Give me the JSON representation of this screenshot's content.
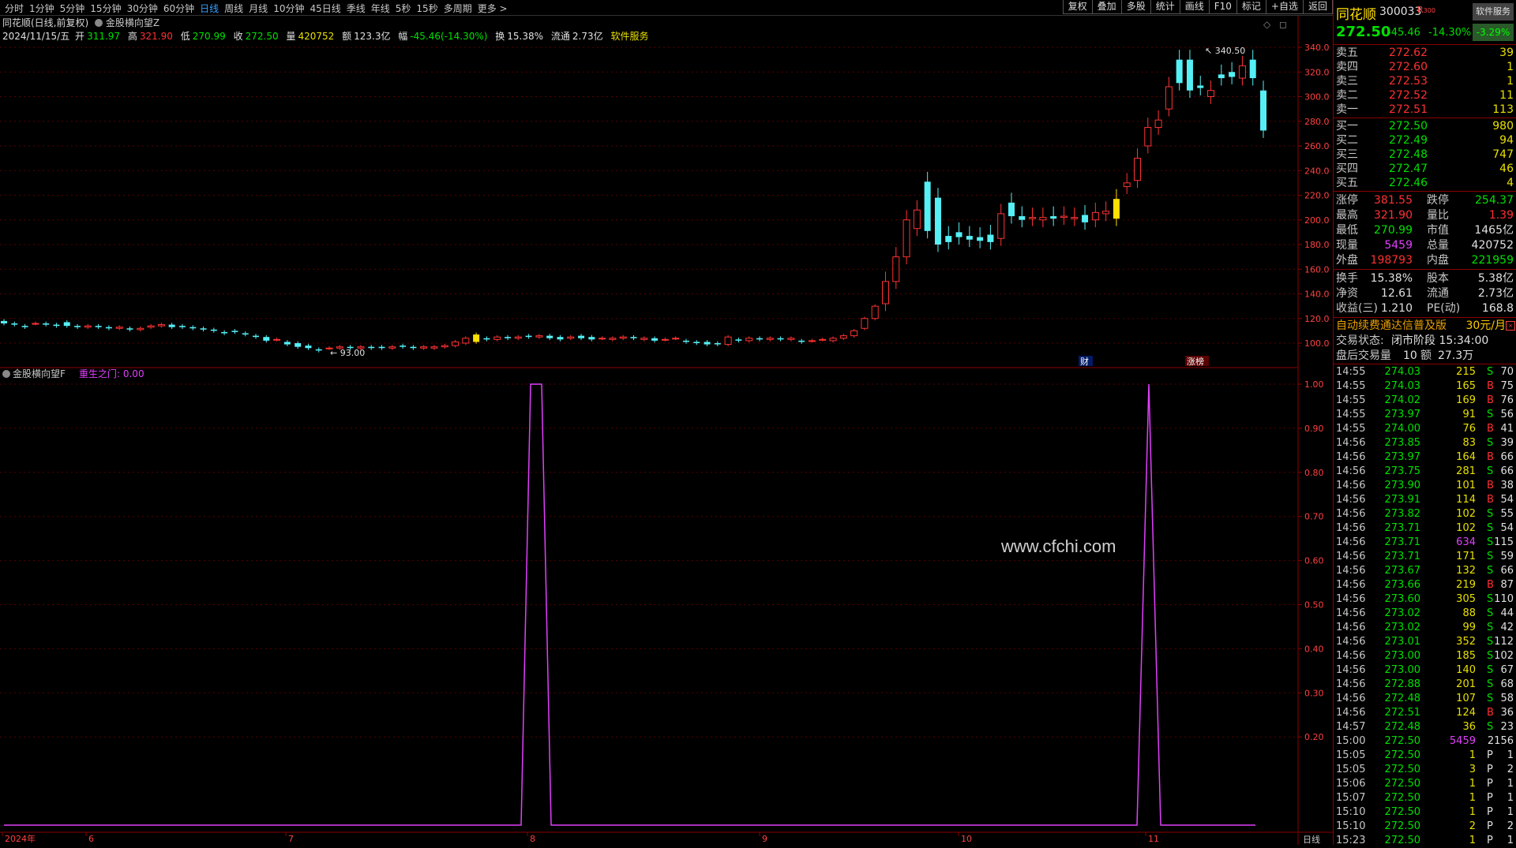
{
  "toolbar": {
    "periods": [
      "分时",
      "1分钟",
      "5分钟",
      "15分钟",
      "30分钟",
      "60分钟",
      "日线",
      "周线",
      "月线",
      "10分钟",
      "45日线",
      "季线",
      "年线",
      "5秒",
      "15秒",
      "多周期",
      "更多 >"
    ],
    "active": "日线",
    "right": [
      "复权",
      "叠加",
      "多股",
      "统计",
      "画线",
      "F10",
      "标记",
      "+自选",
      "返回"
    ]
  },
  "chart_title": "同花顺(日线,前复权)",
  "indicator_main": "金股横向望Z",
  "info": {
    "date": "2024/11/15/五",
    "open_label": "开",
    "open": "311.97",
    "high_label": "高",
    "high": "321.90",
    "low_label": "低",
    "low": "270.99",
    "close_label": "收",
    "close": "272.50",
    "vol_label": "量",
    "vol": "420752",
    "amt_label": "额",
    "amt": "123.3亿",
    "chg_label": "幅",
    "chg": "-45.46(-14.30%)",
    "turn_label": "换",
    "turn": "15.38%",
    "float_label": "流通",
    "float": "2.73亿",
    "service": "软件服务"
  },
  "price_axis": [
    "340.0",
    "320.0",
    "300.0",
    "280.0",
    "260.0",
    "240.0",
    "220.0",
    "200.0",
    "180.0",
    "160.0",
    "140.0",
    "120.0",
    "100.0"
  ],
  "price_high_label": "340.50",
  "price_low_label": "93.00",
  "tags": {
    "cai": "财",
    "zhangbang": "涨榜"
  },
  "indicator_sub": {
    "name": "金股横向望F",
    "param_label": "重生之门:",
    "param_value": "0.00"
  },
  "sub_axis": [
    "1.00",
    "0.90",
    "0.80",
    "0.70",
    "0.60",
    "0.50",
    "0.40",
    "0.30",
    "0.20"
  ],
  "x_axis": [
    "2024年",
    "6",
    "7",
    "8",
    "9",
    "10",
    "11"
  ],
  "period_label": "日线",
  "watermark": "www.cfchi.com",
  "chart_data": {
    "type": "line",
    "title": "",
    "series": [
      {
        "name": "重生之门",
        "x": [
          "2024-05-06",
          "2024-07-31",
          "2024-08-01",
          "2024-08-02",
          "2024-08-05",
          "2024-10-31",
          "2024-11-01",
          "2024-11-04",
          "2024-11-15"
        ],
        "values": [
          0,
          0,
          1,
          1,
          0,
          0,
          1,
          0,
          0
        ]
      }
    ],
    "ylim": [
      0,
      1
    ],
    "price_range": [
      93.0,
      340.5
    ]
  },
  "side": {
    "name": "同花顺",
    "code": "300033",
    "r_label": "R",
    "r_num": "300",
    "soft_btn": "软件服务",
    "price": "272.50",
    "change": "-45.46",
    "pct": "-14.30%",
    "sector_pct": "-3.29%",
    "asks": [
      {
        "l": "卖五",
        "p": "272.62",
        "v": "39"
      },
      {
        "l": "卖四",
        "p": "272.60",
        "v": "1"
      },
      {
        "l": "卖三",
        "p": "272.53",
        "v": "1"
      },
      {
        "l": "卖二",
        "p": "272.52",
        "v": "11"
      },
      {
        "l": "卖一",
        "p": "272.51",
        "v": "113"
      }
    ],
    "bids": [
      {
        "l": "买一",
        "p": "272.50",
        "v": "980"
      },
      {
        "l": "买二",
        "p": "272.49",
        "v": "94"
      },
      {
        "l": "买三",
        "p": "272.48",
        "v": "747"
      },
      {
        "l": "买四",
        "p": "272.47",
        "v": "46"
      },
      {
        "l": "买五",
        "p": "272.46",
        "v": "4"
      }
    ],
    "stats": [
      {
        "l": "涨停",
        "v": "381.55",
        "l2": "跌停",
        "v2": "254.37",
        "c1": "rd",
        "c2": "g"
      },
      {
        "l": "最高",
        "v": "321.90",
        "l2": "量比",
        "v2": "1.39",
        "c1": "rd",
        "c2": "rd"
      },
      {
        "l": "最低",
        "v": "270.99",
        "l2": "市值",
        "v2": "1465亿",
        "c1": "g",
        "c2": "w"
      },
      {
        "l": "现量",
        "v": "5459",
        "l2": "总量",
        "v2": "420752",
        "c1": "m",
        "c2": "w"
      },
      {
        "l": "外盘",
        "v": "198793",
        "l2": "内盘",
        "v2": "221959",
        "c1": "rd",
        "c2": "g"
      }
    ],
    "stats2": [
      {
        "l": "换手",
        "v": "15.38%",
        "l2": "股本",
        "v2": "5.38亿"
      },
      {
        "l": "净资",
        "v": "12.61",
        "l2": "流通",
        "v2": "2.73亿"
      },
      {
        "l": "收益(三)",
        "v": "1.210",
        "l2": "PE(动)",
        "v2": "168.8"
      }
    ],
    "promo": "自动续费通达信普及版",
    "promo_price": "30元/月",
    "trade_state_label": "交易状态:",
    "trade_state": "闭市阶段 15:34:00",
    "after_label": "盘后交易量",
    "after_vol": "10",
    "after_amt_label": "额",
    "after_amt": "27.3万",
    "ticks": [
      [
        "14:55",
        "274.03",
        "215",
        "S",
        "70"
      ],
      [
        "14:55",
        "274.03",
        "165",
        "B",
        "75"
      ],
      [
        "14:55",
        "274.02",
        "169",
        "B",
        "76"
      ],
      [
        "14:55",
        "273.97",
        "91",
        "S",
        "56"
      ],
      [
        "14:55",
        "274.00",
        "76",
        "B",
        "41"
      ],
      [
        "14:56",
        "273.85",
        "83",
        "S",
        "39"
      ],
      [
        "14:56",
        "273.97",
        "164",
        "B",
        "66"
      ],
      [
        "14:56",
        "273.75",
        "281",
        "S",
        "66"
      ],
      [
        "14:56",
        "273.90",
        "101",
        "B",
        "38"
      ],
      [
        "14:56",
        "273.91",
        "114",
        "B",
        "54"
      ],
      [
        "14:56",
        "273.82",
        "102",
        "S",
        "55"
      ],
      [
        "14:56",
        "273.71",
        "102",
        "S",
        "54"
      ],
      [
        "14:56",
        "273.71",
        "634",
        "S",
        "115"
      ],
      [
        "14:56",
        "273.71",
        "171",
        "S",
        "59"
      ],
      [
        "14:56",
        "273.67",
        "132",
        "S",
        "66"
      ],
      [
        "14:56",
        "273.66",
        "219",
        "B",
        "87"
      ],
      [
        "14:56",
        "273.60",
        "305",
        "S",
        "110"
      ],
      [
        "14:56",
        "273.02",
        "88",
        "S",
        "44"
      ],
      [
        "14:56",
        "273.02",
        "99",
        "S",
        "42"
      ],
      [
        "14:56",
        "273.01",
        "352",
        "S",
        "112"
      ],
      [
        "14:56",
        "273.00",
        "185",
        "S",
        "102"
      ],
      [
        "14:56",
        "273.00",
        "140",
        "S",
        "67"
      ],
      [
        "14:56",
        "272.88",
        "201",
        "S",
        "68"
      ],
      [
        "14:56",
        "272.48",
        "107",
        "S",
        "58"
      ],
      [
        "14:56",
        "272.51",
        "124",
        "B",
        "36"
      ],
      [
        "14:57",
        "272.48",
        "36",
        "S",
        "23"
      ],
      [
        "15:00",
        "272.50",
        "5459",
        "",
        "2156"
      ],
      [
        "15:05",
        "272.50",
        "1",
        "P",
        "1"
      ],
      [
        "15:05",
        "272.50",
        "3",
        "P",
        "2"
      ],
      [
        "15:06",
        "272.50",
        "1",
        "P",
        "1"
      ],
      [
        "15:07",
        "272.50",
        "1",
        "P",
        "1"
      ],
      [
        "15:10",
        "272.50",
        "1",
        "P",
        "1"
      ],
      [
        "15:10",
        "272.50",
        "2",
        "P",
        "2"
      ],
      [
        "15:23",
        "272.50",
        "1",
        "P",
        "1"
      ]
    ]
  }
}
